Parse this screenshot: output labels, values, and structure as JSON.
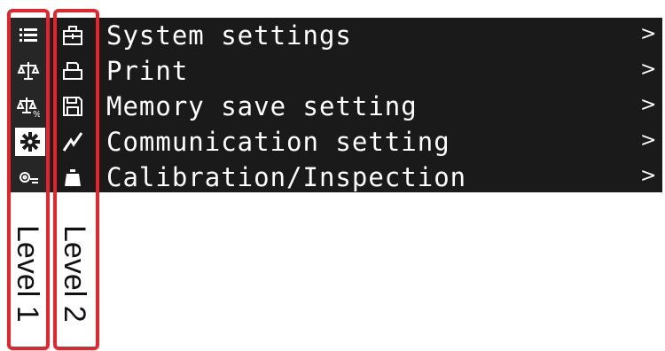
{
  "menu": {
    "items": [
      {
        "label": "System settings",
        "level1_icon": "list-icon",
        "level2_icon": "toolbox-icon",
        "chevron": ">"
      },
      {
        "label": "Print",
        "level1_icon": "balance-scale-icon",
        "level2_icon": "printer-icon",
        "chevron": ">"
      },
      {
        "label": "Memory save setting",
        "level1_icon": "scale-percent-icon",
        "level2_icon": "floppy-disk-icon",
        "chevron": ">"
      },
      {
        "label": "Communication setting",
        "level1_icon": "gear-icon",
        "level2_icon": "signal-zigzag-icon",
        "chevron": ">"
      },
      {
        "label": "Calibration/Inspection",
        "level1_icon": "weight-set-icon",
        "level2_icon": "weight-icon",
        "chevron": ">"
      }
    ],
    "active_level1_index": 3
  },
  "annotations": {
    "level1": "Level 1",
    "level2": "Level 2",
    "outline_color": "#e8232a"
  },
  "colors": {
    "panel_bg": "#1a1a1a",
    "text": "#ffffff"
  }
}
